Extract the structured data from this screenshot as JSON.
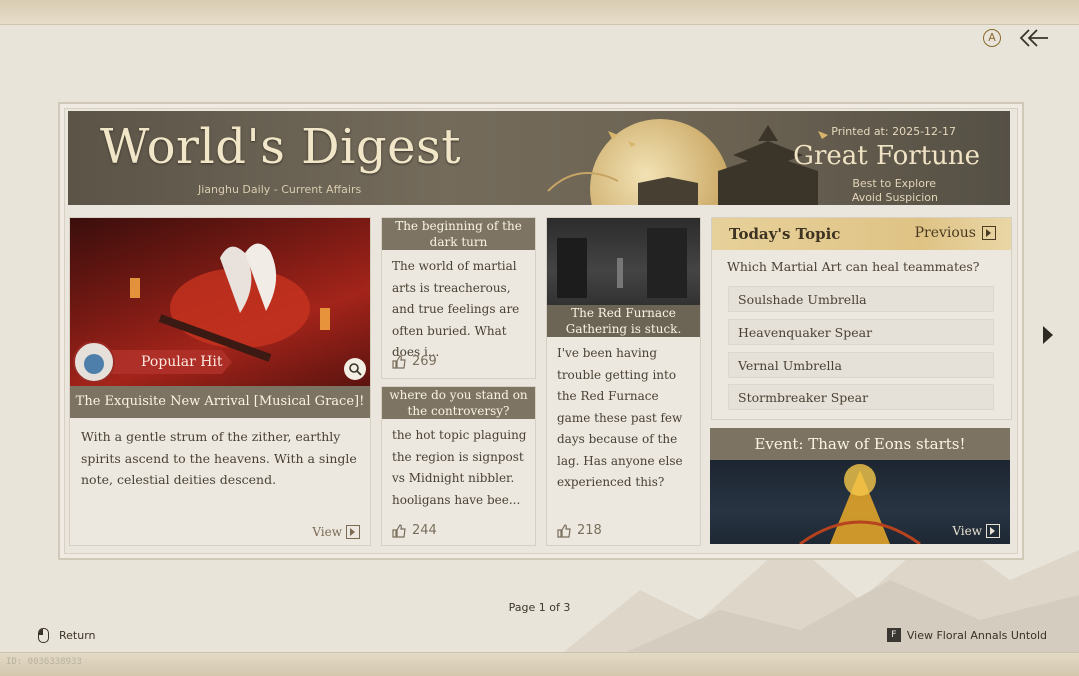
{
  "banner": {
    "title": "World's Digest",
    "subtitle": "Jianghu Daily - Current Affairs",
    "printed": "Printed at: 2025-12-17",
    "fortune": "Great Fortune",
    "fortune_line1": "Best to Explore",
    "fortune_line2": "Avoid Suspicion"
  },
  "featured": {
    "badge": "Popular Hit",
    "caption": "The Exquisite New Arrival [Musical Grace]!",
    "description": "With a gentle strum of the zither, earthly spirits ascend to the heavens. With a single note, celestial deities descend.",
    "view_label": "View"
  },
  "posts": [
    {
      "title": "The beginning of the dark turn",
      "body": "The world of martial arts is treacherous, and true feelings are often buried. What does i...",
      "likes": "269"
    },
    {
      "title": "where do you stand on the controversy?",
      "body": "the hot topic plaguing the region is signpost vs Midnight nibbler. hooligans have bee...",
      "likes": "244"
    },
    {
      "title": "The Red Furnace Gathering is stuck.",
      "body": "I've been having trouble getting into the Red Furnace game these past few days because of the lag. Has anyone else experienced this?",
      "likes": "218"
    }
  ],
  "topic": {
    "title": "Today's Topic",
    "previous_label": "Previous",
    "question": "Which Martial Art can heal teammates?",
    "options": [
      "Soulshade Umbrella",
      "Heavenquaker Spear",
      "Vernal Umbrella",
      "Stormbreaker Spear"
    ]
  },
  "event": {
    "title": "Event: Thaw of Eons starts!",
    "view_label": "View"
  },
  "footer": {
    "page": "Page 1 of 3",
    "return_label": "Return",
    "floral_key": "F",
    "floral_label": "View Floral Annals Untold",
    "uid": "ID: 0036338933"
  },
  "colors": {
    "background": "#e9e4da",
    "card_header": "#7c7363",
    "topic_gold": "#dfc385",
    "text": "#4a4033"
  }
}
